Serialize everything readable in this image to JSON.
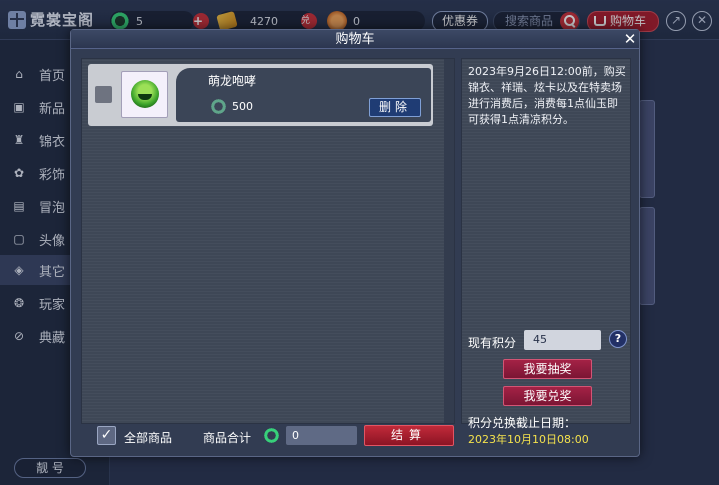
{
  "app": {
    "title": "霓裳宝阁"
  },
  "topbar": {
    "jade_count": "5",
    "ticket_count": "4270",
    "dui_label": "兑",
    "coin_count": "0",
    "coupon_label": "优惠券",
    "search_placeholder": "搜索商品",
    "cart_label": "购物车"
  },
  "sidebar": {
    "items": [
      {
        "label": "首页",
        "icon": "home-icon"
      },
      {
        "label": "新品",
        "icon": "gift-icon"
      },
      {
        "label": "锦衣",
        "icon": "shirt-icon"
      },
      {
        "label": "彩饰",
        "icon": "ornament-icon"
      },
      {
        "label": "冒泡",
        "icon": "chat-bubble-icon"
      },
      {
        "label": "头像",
        "icon": "portrait-icon"
      },
      {
        "label": "其它",
        "icon": "layers-icon"
      },
      {
        "label": "玩家",
        "icon": "player-icon"
      },
      {
        "label": "典藏",
        "icon": "block-icon"
      }
    ],
    "account_label": "靓 号",
    "active_index": 6
  },
  "cart": {
    "title": "购物车",
    "close": "✕",
    "items": [
      {
        "name": "萌龙咆哮",
        "price": "500",
        "delete_label": "删除"
      }
    ],
    "select_all_label": "全部商品",
    "total_label": "商品合计",
    "total_value": "0",
    "checkout_label": "结算"
  },
  "info": {
    "promo_text": "2023年9月26日12:00前，购买锦衣、祥瑞、炫卡以及在特卖场进行消费后，消费每1点仙玉即可获得1点清凉积分。",
    "points_label": "现有积分",
    "points_value": "45",
    "help": "?",
    "lottery_label": "我要抽奖",
    "redeem_label": "我要兑奖",
    "deadline_label": "积分兑换截止日期：",
    "deadline_date": "2023年10月10日08:00"
  },
  "colors": {
    "accent_red": "#a71c2c",
    "deadline_yellow": "#f4e24d",
    "jade_green": "#37d07a"
  }
}
